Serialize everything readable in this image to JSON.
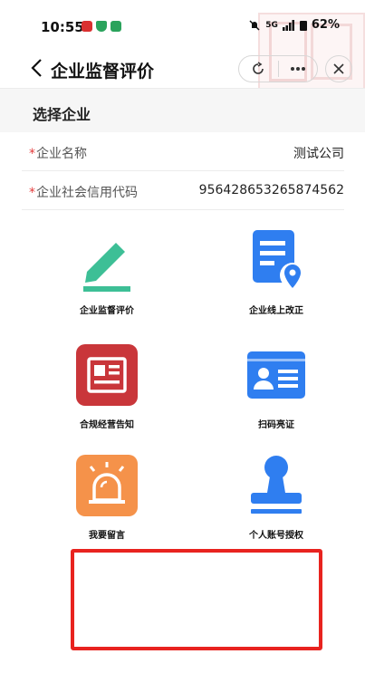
{
  "status_bar": {
    "time": "10:55",
    "network": "5G",
    "battery": "62%"
  },
  "nav": {
    "title": "企业监督评价"
  },
  "section": {
    "title": "选择企业"
  },
  "form": {
    "rows": [
      {
        "required": "*",
        "label": "企业名称",
        "value": "测试公司"
      },
      {
        "required": "*",
        "label": "企业社会信用代码",
        "value": "956428653265874562"
      }
    ]
  },
  "grid": {
    "items": [
      {
        "label": "企业监督评价",
        "icon": "pen-icon"
      },
      {
        "label": "企业线上改正",
        "icon": "document-location-icon"
      },
      {
        "label": "合规经营告知",
        "icon": "newspaper-icon"
      },
      {
        "label": "扫码亮证",
        "icon": "id-card-icon"
      },
      {
        "label": "我要留言",
        "icon": "alarm-icon"
      },
      {
        "label": "个人账号授权",
        "icon": "stamp-icon"
      }
    ]
  },
  "colors": {
    "green": "#3dbf96",
    "blue": "#2f7ef0",
    "red": "#c9363a",
    "orange": "#f5924a",
    "required": "#e33b3b",
    "frame": "#e8231f"
  }
}
